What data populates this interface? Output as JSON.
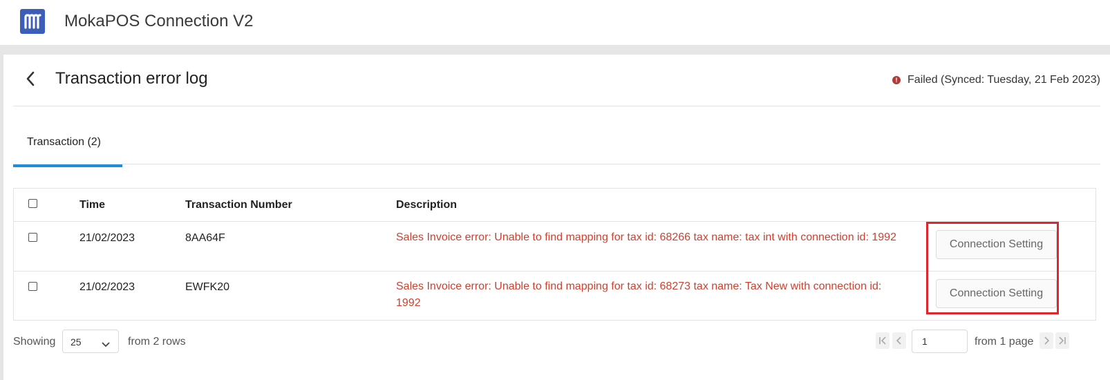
{
  "app": {
    "title": "MokaPOS Connection V2",
    "logo_icon": "moka-logo-icon",
    "brand_color": "#3b5eb8"
  },
  "page": {
    "title": "Transaction error log",
    "status_text": "Failed (Synced: Tuesday, 21 Feb 2023)",
    "status_color": "#b23a3a"
  },
  "tabs": [
    {
      "label": "Transaction (2)",
      "active": true
    }
  ],
  "table": {
    "headers": {
      "time": "Time",
      "number": "Transaction Number",
      "description": "Description"
    },
    "rows": [
      {
        "time": "21/02/2023",
        "number": "8AA64F",
        "description": "Sales Invoice error: Unable to find mapping for tax id: 68266 tax name: tax int with connection id: 1992",
        "action": "Connection Setting"
      },
      {
        "time": "21/02/2023",
        "number": "EWFK20",
        "description": "Sales Invoice error: Unable to find mapping for tax id: 68273 tax name: Tax New with connection id: 1992",
        "action": "Connection Setting"
      }
    ]
  },
  "footer": {
    "showing_label": "Showing",
    "page_size": "25",
    "rows_text": "from 2 rows",
    "page_number": "1",
    "pages_text": "from 1 page"
  },
  "colors": {
    "error_text": "#d0402f",
    "tab_accent": "#1a8fd8",
    "highlight": "#e0262a"
  }
}
